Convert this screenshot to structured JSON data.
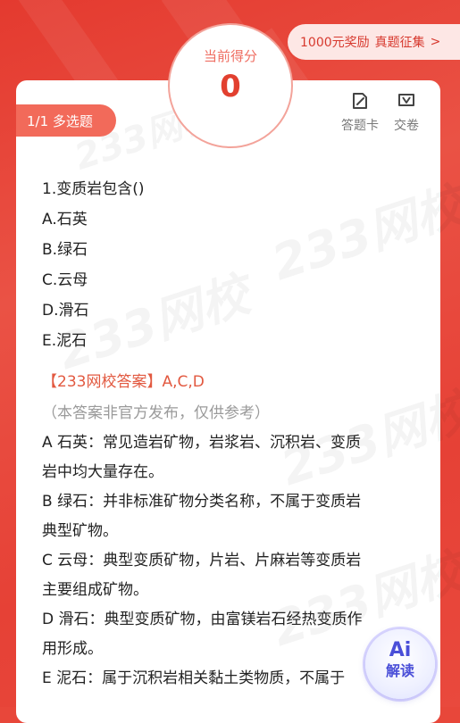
{
  "banner": {
    "prefix": "1000元奖励",
    "action": "真题征集",
    "arrow": ">"
  },
  "score": {
    "label": "当前得分",
    "value": "0"
  },
  "question_tag": "1/1  多选题",
  "tools": {
    "answer_card": "答题卡",
    "submit": "交卷"
  },
  "icons": {
    "answer_card": "edit-sheet-icon",
    "submit": "send-icon"
  },
  "question": {
    "stem": "1.变质岩包含()",
    "options": [
      "A.石英",
      "B.绿石",
      "C.云母",
      "D.滑石",
      "E.泥石"
    ]
  },
  "answer_line": "【233网校答案】A,C,D",
  "answer_note": "（本答案非官方发布，仅供参考）",
  "explanations": [
    "A 石英：常见造岩矿物，岩浆岩、沉积岩、变质",
    "岩中均大量存在。",
    "B 绿石：并非标准矿物分类名称，不属于变质岩",
    "典型矿物。",
    "C 云母：典型变质矿物，片岩、片麻岩等变质岩",
    "主要组成矿物。",
    "D 滑石：典型变质矿物，由富镁岩石经热变质作",
    "用形成。",
    "E 泥石：属于沉积岩相关黏土类物质，不属于"
  ],
  "ai_button": {
    "big": "Ai",
    "small": "解读"
  },
  "watermark": "233网校",
  "colors": {
    "brand_red": "#e43a2f",
    "answer_red": "#e25940",
    "ai_blue": "#4a4fd8"
  }
}
